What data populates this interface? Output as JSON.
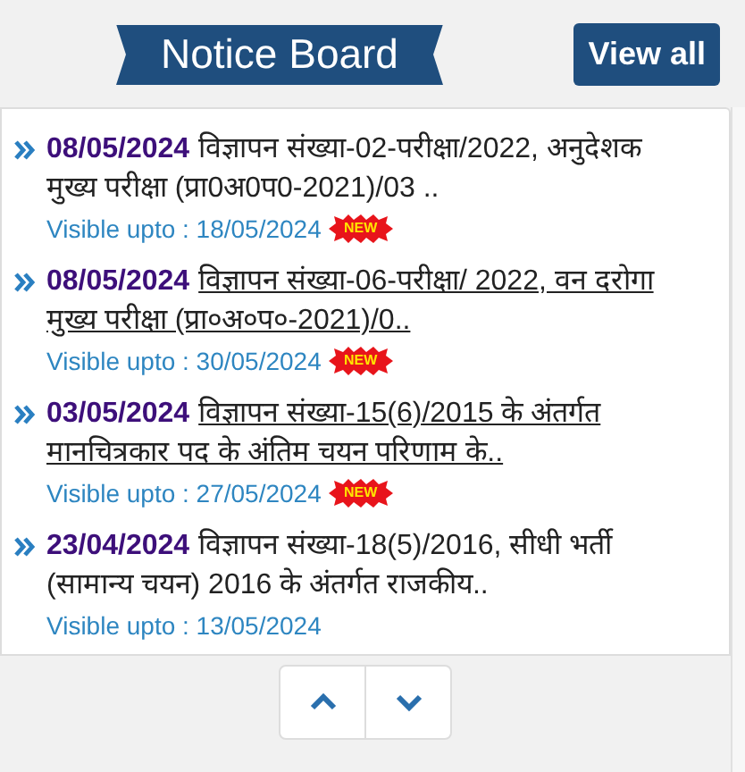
{
  "header": {
    "title": "Notice Board",
    "view_all": "View all"
  },
  "notices": [
    {
      "date": "08/05/2024",
      "text": "विज्ञापन संख्या-02-परीक्षा/2022, अनुदेशक मुख्य परीक्षा (प्रा0अ0प0-2021)/03 ..",
      "link": false,
      "visible": "Visible upto : 18/05/2024",
      "badge": "NEW"
    },
    {
      "date": "08/05/2024",
      "text": "विज्ञापन संख्या-06-परीक्षा/ 2022, वन दरोगा मुख्य परीक्षा (प्रा०अ०प०-2021)/0..",
      "link": true,
      "visible": "Visible upto : 30/05/2024",
      "badge": "NEW"
    },
    {
      "date": "03/05/2024",
      "text": "विज्ञापन संख्या-15(6)/2015 के अंतर्गत मानचित्रकार पद के अंतिम चयन परिणाम के..",
      "link": true,
      "visible": "Visible upto : 27/05/2024",
      "badge": "NEW"
    },
    {
      "date": "23/04/2024",
      "text": "विज्ञापन संख्या-18(5)/2016, सीधी भर्ती (सामान्य चयन) 2016 के अंतर्गत राजकीय..",
      "link": false,
      "visible": "Visible upto : 13/05/2024"
    }
  ]
}
